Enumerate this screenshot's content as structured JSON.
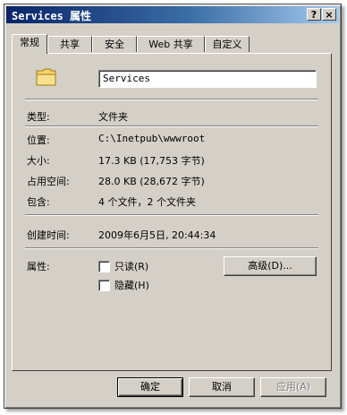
{
  "window": {
    "title": "Services 属性",
    "help_glyph": "?",
    "close_glyph": "×"
  },
  "tabs": [
    {
      "label": "常规",
      "active": true
    },
    {
      "label": "共享"
    },
    {
      "label": "安全"
    },
    {
      "label": "Web 共享"
    },
    {
      "label": "自定义"
    }
  ],
  "general": {
    "folder_icon": "folder-icon",
    "name_value": "Services",
    "type_label": "类型:",
    "type_value": "文件夹",
    "location_label": "位置:",
    "location_value": "C:\\Inetpub\\wwwroot",
    "size_label": "大小:",
    "size_value": "17.3 KB (17,753 字节)",
    "size_on_disk_label": "占用空间:",
    "size_on_disk_value": "28.0 KB (28,672 字节)",
    "contains_label": "包含:",
    "contains_value": "4 个文件，2 个文件夹",
    "created_label": "创建时间:",
    "created_value": "2009年6月5日, 20:44:34",
    "attributes_label": "属性:",
    "readonly_label": "只读(R)",
    "readonly_checked": false,
    "hidden_label": "隐藏(H)",
    "hidden_checked": false,
    "advanced_button": "高级(D)..."
  },
  "footer": {
    "ok": "确定",
    "cancel": "取消",
    "apply": "应用(A)"
  }
}
